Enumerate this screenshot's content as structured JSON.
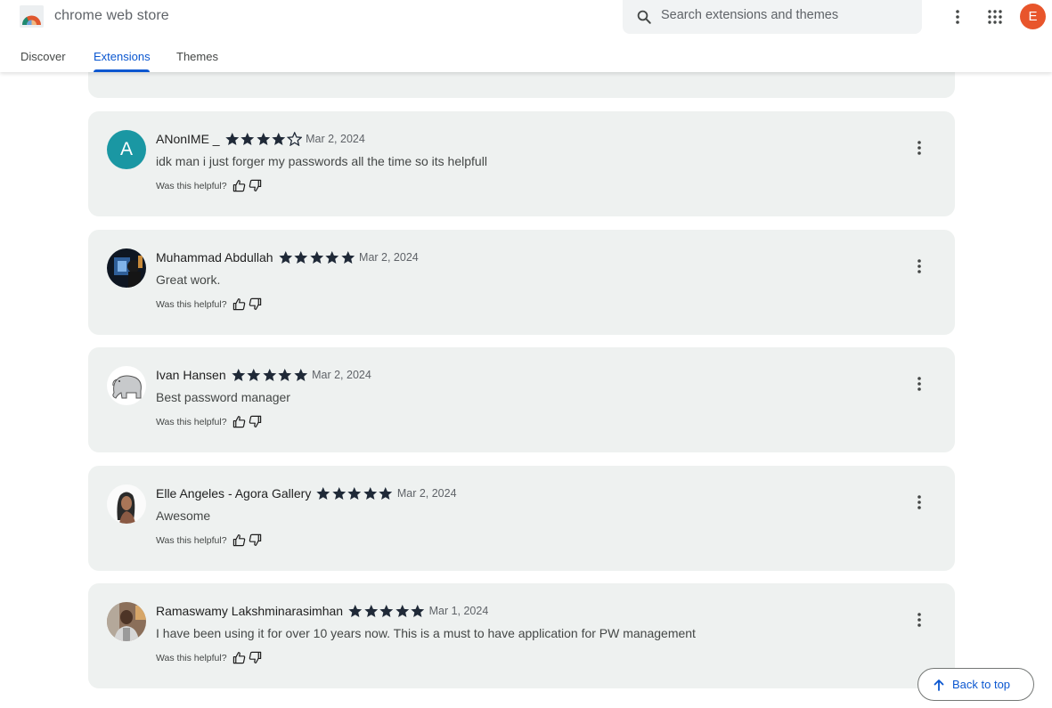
{
  "header": {
    "brand": "chrome web store",
    "tabs": [
      {
        "label": "Discover",
        "active": false
      },
      {
        "label": "Extensions",
        "active": true
      },
      {
        "label": "Themes",
        "active": false
      }
    ],
    "search": {
      "placeholder": "Search extensions and themes",
      "value": ""
    },
    "account_initial": "E",
    "icons": {
      "search": "search-icon",
      "menu": "more-vert-icon",
      "apps": "apps-grid-icon"
    }
  },
  "colors": {
    "accent": "#0b57d0",
    "card_bg": "#eef1f0",
    "avatar_account": "#e8552b",
    "avatar_letter": "#1a97a3",
    "star": "#1f2937"
  },
  "reviews": [
    {
      "author": "ANonIME _",
      "avatar": "A",
      "rating": 4,
      "max_rating": 5,
      "date": "Mar 2, 2024",
      "text": "idk man i just forger my passwords all the time so its helpfull",
      "helpful_label": "Was this helpful?"
    },
    {
      "author": "Muhammad Abdullah",
      "avatar": "photo",
      "rating": 5,
      "max_rating": 5,
      "date": "Mar 2, 2024",
      "text": "Great work.",
      "helpful_label": "Was this helpful?"
    },
    {
      "author": "Ivan Hansen",
      "avatar": "photo",
      "rating": 5,
      "max_rating": 5,
      "date": "Mar 2, 2024",
      "text": "Best password manager",
      "helpful_label": "Was this helpful?"
    },
    {
      "author": "Elle Angeles - Agora Gallery",
      "avatar": "photo",
      "rating": 5,
      "max_rating": 5,
      "date": "Mar 2, 2024",
      "text": "Awesome",
      "helpful_label": "Was this helpful?"
    },
    {
      "author": "Ramaswamy Lakshminarasimhan",
      "avatar": "photo",
      "rating": 5,
      "max_rating": 5,
      "date": "Mar 1, 2024",
      "text": "I have been using it for over 10 years now.  This is a must to have application for PW management",
      "helpful_label": "Was this helpful?"
    }
  ],
  "back_to_top": {
    "label": "Back to top"
  }
}
